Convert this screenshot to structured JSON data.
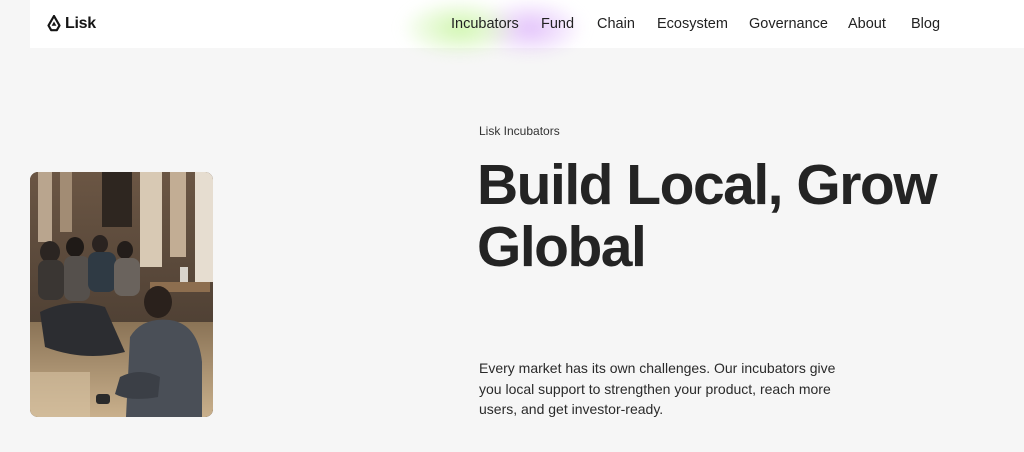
{
  "brand": {
    "name": "Lisk",
    "logo_icon": "lisk-logo-icon"
  },
  "nav": {
    "items": [
      {
        "label": "Incubators",
        "active": true
      },
      {
        "label": "Fund"
      },
      {
        "label": "Chain"
      },
      {
        "label": "Ecosystem"
      },
      {
        "label": "Governance"
      },
      {
        "label": "About"
      },
      {
        "label": "Blog"
      }
    ]
  },
  "hero": {
    "eyebrow": "Lisk Incubators",
    "title": "Build Local, Grow Global",
    "description": "Every market has its own challenges. Our incubators give you local support to strengthen your product, reach more users, and get investor-ready."
  },
  "colors": {
    "background": "#f6f6f6",
    "header_bg": "#ffffff",
    "text": "#242424",
    "glow_green": "#cdf5aa",
    "glow_purple": "#e1befa"
  }
}
